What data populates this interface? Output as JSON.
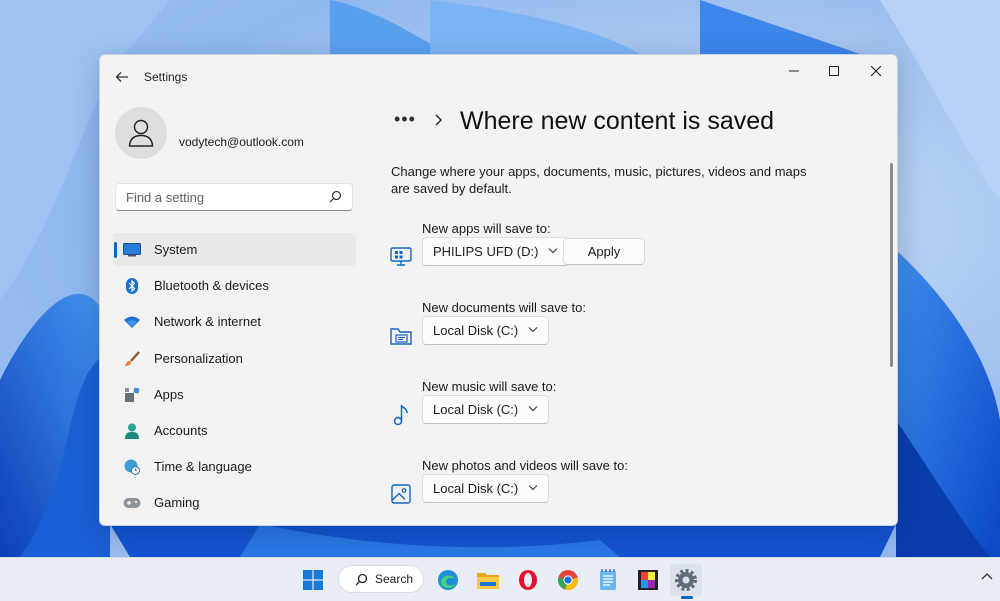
{
  "window": {
    "title": "Settings"
  },
  "account": {
    "email": "vodytech@outlook.com"
  },
  "sidebar": {
    "search_placeholder": "Find a setting",
    "items": [
      {
        "label": "System",
        "icon": "system-icon",
        "active": true
      },
      {
        "label": "Bluetooth & devices",
        "icon": "bluetooth-icon",
        "active": false
      },
      {
        "label": "Network & internet",
        "icon": "wifi-icon",
        "active": false
      },
      {
        "label": "Personalization",
        "icon": "brush-icon",
        "active": false
      },
      {
        "label": "Apps",
        "icon": "apps-icon",
        "active": false
      },
      {
        "label": "Accounts",
        "icon": "person-icon",
        "active": false
      },
      {
        "label": "Time & language",
        "icon": "globe-clock-icon",
        "active": false
      },
      {
        "label": "Gaming",
        "icon": "gamepad-icon",
        "active": false
      }
    ]
  },
  "main": {
    "breadcrumb_more": "•••",
    "title": "Where new content is saved",
    "description": "Change where your apps, documents, music, pictures, videos and maps are saved by default.",
    "settings": [
      {
        "label": "New apps will save to:",
        "value": "PHILIPS UFD (D:)",
        "icon": "apps-monitor-icon",
        "button": "Apply"
      },
      {
        "label": "New documents will save to:",
        "value": "Local Disk (C:)",
        "icon": "documents-folder-icon"
      },
      {
        "label": "New music will save to:",
        "value": "Local Disk (C:)",
        "icon": "music-note-icon"
      },
      {
        "label": "New photos and videos will save to:",
        "value": "Local Disk (C:)",
        "icon": "photo-icon"
      }
    ]
  },
  "taskbar": {
    "search_label": "Search",
    "apps": [
      "start-icon",
      "edge-icon",
      "file-explorer-icon",
      "opera-icon",
      "chrome-icon",
      "notepad-icon",
      "photos-icon",
      "settings-icon"
    ]
  },
  "colors": {
    "accent": "#1264c8",
    "window_bg": "#f3f3f3",
    "taskbar_bg": "#e9eef6"
  }
}
